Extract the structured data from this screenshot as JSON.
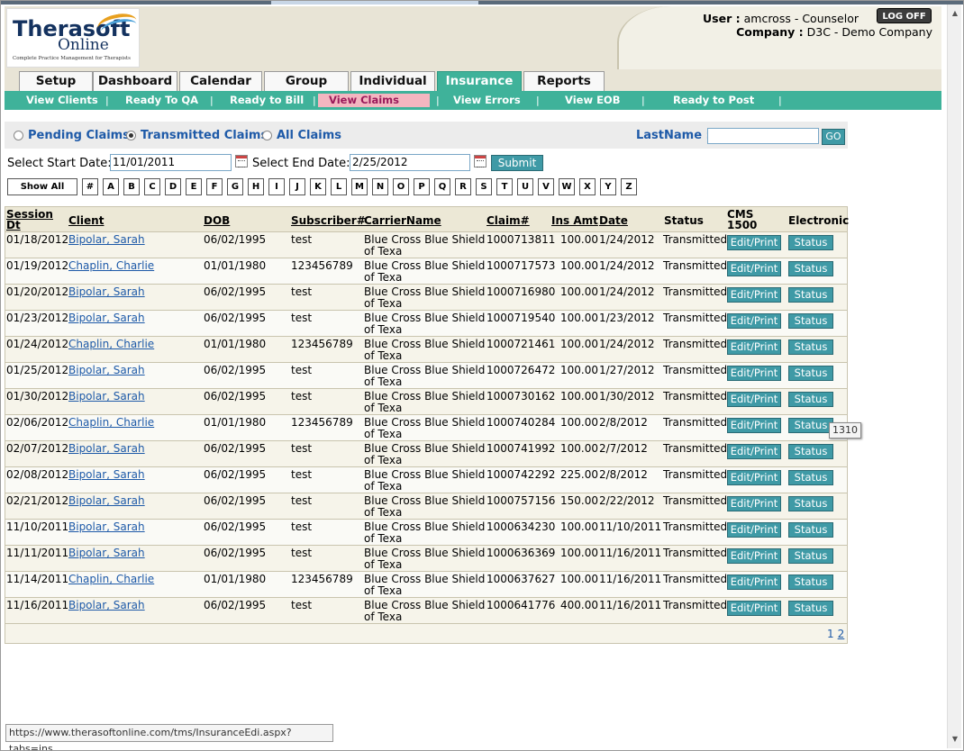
{
  "header": {
    "logo": {
      "line1": "Therasoft",
      "line2": "Online",
      "tagline": "Complete Practice Management for Therapists"
    },
    "user_label": "User :",
    "user_value": "amcross - Counselor",
    "company_label": "Company :",
    "company_value": "D3C - Demo Company",
    "logoff_label": "LOG OFF"
  },
  "tabs": [
    "Setup",
    "Dashboard",
    "Calendar",
    "Group",
    "Individual",
    "Insurance",
    "Reports"
  ],
  "active_tab": "Insurance",
  "subnav": [
    "View Clients",
    "Ready To QA",
    "Ready to Bill",
    "View Claims",
    "View Errors",
    "View EOB",
    "Ready to Post"
  ],
  "active_subnav": "View Claims",
  "filter": {
    "radios": [
      "Pending Claims",
      "Transmitted Claims",
      "All Claims"
    ],
    "selected": "Transmitted Claims",
    "lastname_label": "LastName :",
    "lastname_value": "",
    "go_label": "GO"
  },
  "dates": {
    "start_label": "Select Start Date:",
    "start_value": "11/01/2011",
    "end_label": "Select End Date:",
    "end_value": "2/25/2012",
    "submit_label": "Submit"
  },
  "letters": {
    "show_all": "Show All",
    "items": [
      "#",
      "A",
      "B",
      "C",
      "D",
      "E",
      "F",
      "G",
      "H",
      "I",
      "J",
      "K",
      "L",
      "M",
      "N",
      "O",
      "P",
      "Q",
      "R",
      "S",
      "T",
      "U",
      "V",
      "W",
      "X",
      "Y",
      "Z"
    ]
  },
  "table": {
    "headers": {
      "session_dt": "Session Dt",
      "client": "Client",
      "dob": "DOB",
      "subscriber": "Subscriber#",
      "carrier": "CarrierName",
      "claim": "Claim#",
      "ins_amt": "Ins Amt",
      "date": "Date",
      "status": "Status",
      "cms": "CMS 1500",
      "electronic": "Electronic"
    },
    "edit_label": "Edit/Print",
    "status_btn_label": "Status",
    "rows": [
      {
        "session": "01/18/2012",
        "client": "Bipolar, Sarah",
        "dob": "06/02/1995",
        "sub": "test",
        "carrier": "Blue Cross Blue Shield of Texa",
        "claim": "1000713811",
        "amt": "100.00",
        "date": "1/24/2012",
        "status": "Transmitted"
      },
      {
        "session": "01/19/2012",
        "client": "Chaplin, Charlie",
        "dob": "01/01/1980",
        "sub": "123456789",
        "carrier": "Blue Cross Blue Shield of Texa",
        "claim": "1000717573",
        "amt": "100.00",
        "date": "1/24/2012",
        "status": "Transmitted"
      },
      {
        "session": "01/20/2012",
        "client": "Bipolar, Sarah",
        "dob": "06/02/1995",
        "sub": "test",
        "carrier": "Blue Cross Blue Shield of Texa",
        "claim": "1000716980",
        "amt": "100.00",
        "date": "1/24/2012",
        "status": "Transmitted"
      },
      {
        "session": "01/23/2012",
        "client": "Bipolar, Sarah",
        "dob": "06/02/1995",
        "sub": "test",
        "carrier": "Blue Cross Blue Shield of Texa",
        "claim": "1000719540",
        "amt": "100.00",
        "date": "1/23/2012",
        "status": "Transmitted"
      },
      {
        "session": "01/24/2012",
        "client": "Chaplin, Charlie",
        "dob": "01/01/1980",
        "sub": "123456789",
        "carrier": "Blue Cross Blue Shield of Texa",
        "claim": "1000721461",
        "amt": "100.00",
        "date": "1/24/2012",
        "status": "Transmitted"
      },
      {
        "session": "01/25/2012",
        "client": "Bipolar, Sarah",
        "dob": "06/02/1995",
        "sub": "test",
        "carrier": "Blue Cross Blue Shield of Texa",
        "claim": "1000726472",
        "amt": "100.00",
        "date": "1/27/2012",
        "status": "Transmitted"
      },
      {
        "session": "01/30/2012",
        "client": "Bipolar, Sarah",
        "dob": "06/02/1995",
        "sub": "test",
        "carrier": "Blue Cross Blue Shield of Texa",
        "claim": "1000730162",
        "amt": "100.00",
        "date": "1/30/2012",
        "status": "Transmitted"
      },
      {
        "session": "02/06/2012",
        "client": "Chaplin, Charlie",
        "dob": "01/01/1980",
        "sub": "123456789",
        "carrier": "Blue Cross Blue Shield of Texa",
        "claim": "1000740284",
        "amt": "100.00",
        "date": "2/8/2012",
        "status": "Transmitted"
      },
      {
        "session": "02/07/2012",
        "client": "Bipolar, Sarah",
        "dob": "06/02/1995",
        "sub": "test",
        "carrier": "Blue Cross Blue Shield of Texa",
        "claim": "1000741992",
        "amt": "100.00",
        "date": "2/7/2012",
        "status": "Transmitted"
      },
      {
        "session": "02/08/2012",
        "client": "Bipolar, Sarah",
        "dob": "06/02/1995",
        "sub": "test",
        "carrier": "Blue Cross Blue Shield of Texa",
        "claim": "1000742292",
        "amt": "225.00",
        "date": "2/8/2012",
        "status": "Transmitted"
      },
      {
        "session": "02/21/2012",
        "client": "Bipolar, Sarah",
        "dob": "06/02/1995",
        "sub": "test",
        "carrier": "Blue Cross Blue Shield of Texa",
        "claim": "1000757156",
        "amt": "150.00",
        "date": "2/22/2012",
        "status": "Transmitted"
      },
      {
        "session": "11/10/2011",
        "client": "Bipolar, Sarah",
        "dob": "06/02/1995",
        "sub": "test",
        "carrier": "Blue Cross Blue Shield of Texa",
        "claim": "1000634230",
        "amt": "100.00",
        "date": "11/10/2011",
        "status": "Transmitted"
      },
      {
        "session": "11/11/2011",
        "client": "Bipolar, Sarah",
        "dob": "06/02/1995",
        "sub": "test",
        "carrier": "Blue Cross Blue Shield of Texa",
        "claim": "1000636369",
        "amt": "100.00",
        "date": "11/16/2011",
        "status": "Transmitted"
      },
      {
        "session": "11/14/2011",
        "client": "Chaplin, Charlie",
        "dob": "01/01/1980",
        "sub": "123456789",
        "carrier": "Blue Cross Blue Shield of Texa",
        "claim": "1000637627",
        "amt": "100.00",
        "date": "11/16/2011",
        "status": "Transmitted"
      },
      {
        "session": "11/16/2011",
        "client": "Bipolar, Sarah",
        "dob": "06/02/1995",
        "sub": "test",
        "carrier": "Blue Cross Blue Shield of Texa",
        "claim": "1000641776",
        "amt": "400.00",
        "date": "11/16/2011",
        "status": "Transmitted"
      }
    ]
  },
  "pager": {
    "pages": [
      "1",
      "2"
    ]
  },
  "tooltip": "1310",
  "status_url": "https://www.therasoftonline.com/tms/InsuranceEdi.aspx?tabs=ins",
  "colors": {
    "accent": "#3fb29a",
    "button": "#3f9aa6",
    "link": "#1e5aa8",
    "header_bg": "#e8e4d6"
  }
}
